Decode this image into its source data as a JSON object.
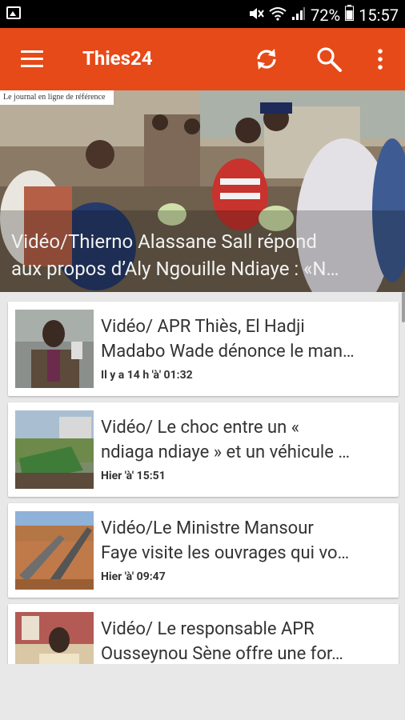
{
  "status_bar": {
    "battery": "72%",
    "time": "15:57"
  },
  "app_bar": {
    "title": "Thies24",
    "accent": "#e64a19"
  },
  "hero": {
    "logo_text": "Le journal en ligne de référence",
    "title_line1": "Vidéo/Thierno Alassane Sall répond",
    "title_line2": "aux propos d’Aly Ngouille Ndiaye : «N…"
  },
  "articles": [
    {
      "line1": "Vidéo/ APR Thiès, El Hadji",
      "line2": "Madabo Wade dénonce le man…",
      "time": "Il y a 14 h 'à' 01:32"
    },
    {
      "line1": "Vidéo/ Le choc entre un «",
      "line2": "ndiaga ndiaye » et un véhicule …",
      "time": "Hier 'à' 15:51"
    },
    {
      "line1": "Vidéo/Le Ministre Mansour",
      "line2": "Faye visite les ouvrages qui vo…",
      "time": "Hier 'à' 09:47"
    },
    {
      "line1": "Vidéo/ Le responsable APR",
      "line2": "Ousseynou Sène offre une for…",
      "time": ""
    }
  ],
  "icons": [
    "menu-icon",
    "refresh-icon",
    "search-icon",
    "more-vert-icon",
    "gallery-icon",
    "mute-icon",
    "wifi-icon",
    "signal-icon",
    "battery-icon"
  ]
}
